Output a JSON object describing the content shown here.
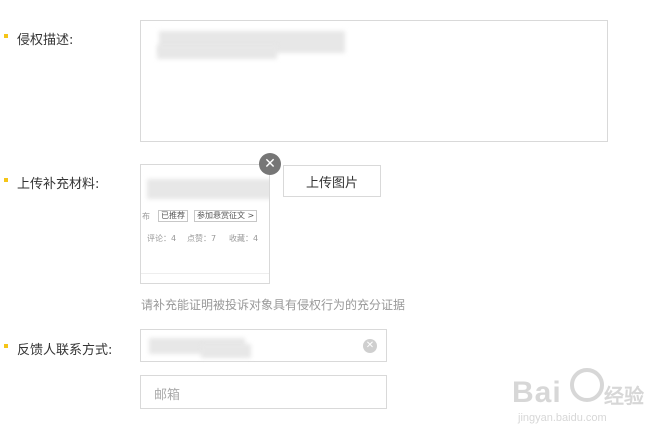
{
  "form": {
    "description_label": "侵权描述:",
    "materials_label": "上传补充材料:",
    "upload_button": "上传图片",
    "close_symbol": "✕",
    "hint": "请补充能证明被投诉对象具有侵权行为的充分证据",
    "contact_label": "反馈人联系方式:",
    "email_placeholder": "邮箱",
    "clear_symbol": "✕"
  },
  "thumbnail": {
    "tag_1": "已推荐",
    "tag_2": "参加悬赏征文 >",
    "prefix": "布",
    "stat_1": "评论：4",
    "stat_2": "点赞：7",
    "stat_3": "收藏：4"
  },
  "watermark": {
    "brand": "Bai",
    "brand_cn": "经验",
    "url": "jingyan.baidu.com"
  },
  "colors": {
    "required_dot": "#f5c518",
    "border": "#d9d9d9",
    "hint_text": "#999999"
  }
}
